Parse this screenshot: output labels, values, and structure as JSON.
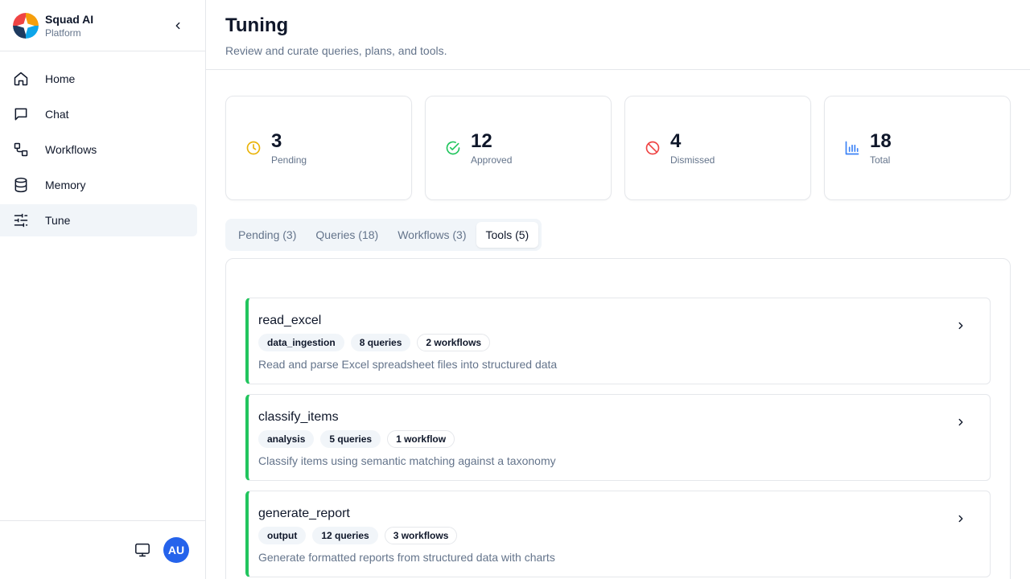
{
  "brand": {
    "name": "Squad AI",
    "subtitle": "Platform"
  },
  "nav": [
    {
      "label": "Home",
      "icon": "home-icon",
      "active": false
    },
    {
      "label": "Chat",
      "icon": "chat-icon",
      "active": false
    },
    {
      "label": "Workflows",
      "icon": "workflows-icon",
      "active": false
    },
    {
      "label": "Memory",
      "icon": "database-icon",
      "active": false
    },
    {
      "label": "Tune",
      "icon": "sliders-icon",
      "active": true
    }
  ],
  "user": {
    "initials": "AU"
  },
  "colors": {
    "accent": "#22c55e",
    "avatar": "#2563eb",
    "pending": "#eab308",
    "approved": "#22c55e",
    "dismissed": "#ef4444",
    "total": "#3b82f6"
  },
  "header": {
    "title": "Tuning",
    "subtitle": "Review and curate queries, plans, and tools."
  },
  "stats": [
    {
      "value": "3",
      "label": "Pending",
      "icon": "clock-icon"
    },
    {
      "value": "12",
      "label": "Approved",
      "icon": "check-circle-icon"
    },
    {
      "value": "4",
      "label": "Dismissed",
      "icon": "ban-icon"
    },
    {
      "value": "18",
      "label": "Total",
      "icon": "bar-chart-icon"
    }
  ],
  "tabs": [
    {
      "label": "Pending (3)",
      "active": false
    },
    {
      "label": "Queries (18)",
      "active": false
    },
    {
      "label": "Workflows (3)",
      "active": false
    },
    {
      "label": "Tools (5)",
      "active": true
    }
  ],
  "tools": [
    {
      "name": "read_excel",
      "category": "data_ingestion",
      "queries": "8 queries",
      "workflows": "2 workflows",
      "description": "Read and parse Excel spreadsheet files into structured data"
    },
    {
      "name": "classify_items",
      "category": "analysis",
      "queries": "5 queries",
      "workflows": "1 workflow",
      "description": "Classify items using semantic matching against a taxonomy"
    },
    {
      "name": "generate_report",
      "category": "output",
      "queries": "12 queries",
      "workflows": "3 workflows",
      "description": "Generate formatted reports from structured data with charts"
    }
  ]
}
